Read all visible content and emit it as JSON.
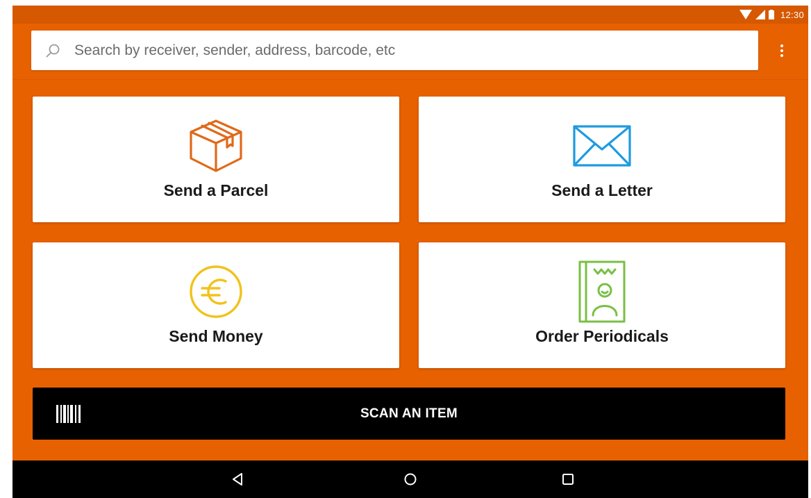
{
  "status_bar": {
    "time": "12:30",
    "icons": [
      "wifi-icon",
      "cell-signal-icon",
      "battery-icon"
    ]
  },
  "search": {
    "placeholder": "Search by receiver, sender, address, barcode, etc",
    "value": "",
    "icon": "search-icon"
  },
  "menu": {
    "icon": "more-vert-icon"
  },
  "tiles": [
    {
      "label": "Send a Parcel",
      "icon": "parcel-box-icon",
      "color": "#e0691a"
    },
    {
      "label": "Send a Letter",
      "icon": "envelope-icon",
      "color": "#1e9be0"
    },
    {
      "label": "Send Money",
      "icon": "euro-coin-icon",
      "color": "#f2c21b"
    },
    {
      "label": "Order Periodicals",
      "icon": "magazine-icon",
      "color": "#78c043"
    }
  ],
  "scan": {
    "label": "SCAN AN ITEM",
    "icon": "barcode-icon"
  },
  "navigation": {
    "buttons": [
      "back-icon",
      "home-icon",
      "recents-icon"
    ]
  },
  "colors": {
    "background": "#e86100",
    "status_bar": "#d65800",
    "scan_button": "#000000",
    "nav_bar": "#000000"
  }
}
